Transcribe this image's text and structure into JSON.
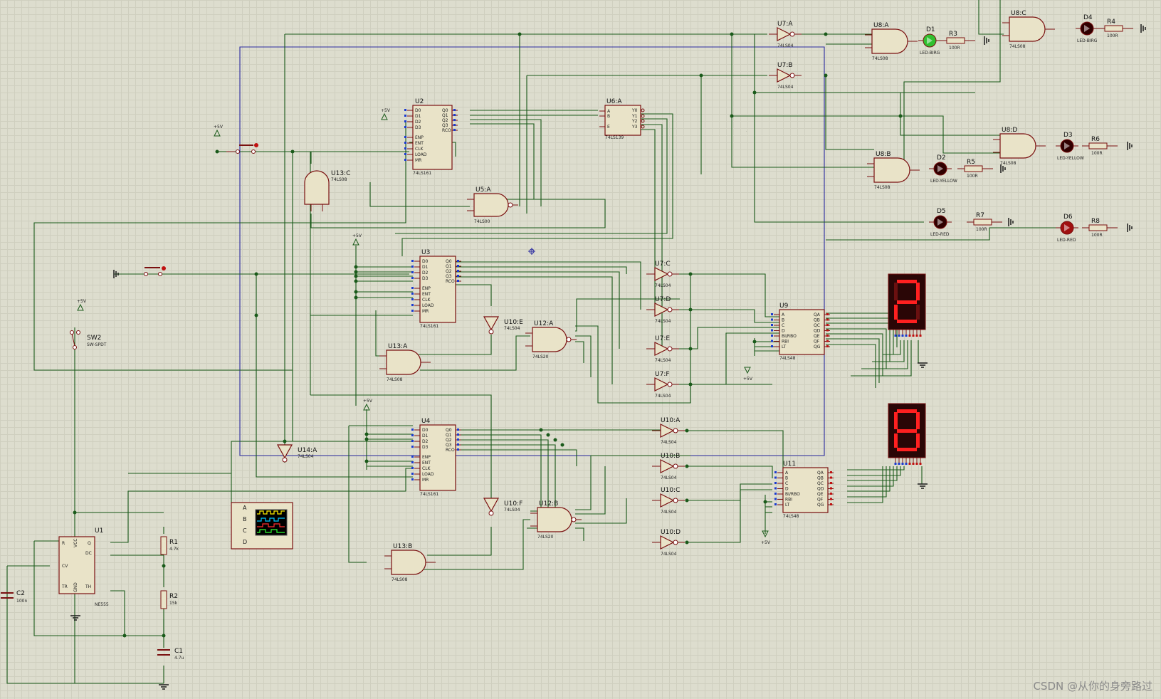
{
  "components": {
    "U1": {
      "ref": "U1",
      "type": "NE555",
      "pins": [
        "R",
        "VCC",
        "Q",
        "DC",
        "CV",
        "TR",
        "GND",
        "TH"
      ]
    },
    "U2": {
      "ref": "U2",
      "type": "74LS161"
    },
    "U3": {
      "ref": "U3",
      "type": "74LS161"
    },
    "U4": {
      "ref": "U4",
      "type": "74LS161"
    },
    "U6A": {
      "ref": "U6:A",
      "type": "74LS139",
      "pins": [
        "A",
        "B",
        "E",
        "Y0",
        "Y1",
        "Y2",
        "Y3"
      ]
    },
    "U9": {
      "ref": "U9",
      "type": "74LS48"
    },
    "U11": {
      "ref": "U11",
      "type": "74LS48"
    },
    "U5A": {
      "ref": "U5:A",
      "type": "74LS00"
    },
    "U8A": {
      "ref": "U8:A",
      "type": "74LS08"
    },
    "U8B": {
      "ref": "U8:B",
      "type": "74LS08"
    },
    "U8C": {
      "ref": "U8:C",
      "type": "74LS08"
    },
    "U8D": {
      "ref": "U8:D",
      "type": "74LS08"
    },
    "U13A": {
      "ref": "U13:A",
      "type": "74LS08"
    },
    "U13B": {
      "ref": "U13:B",
      "type": "74LS08"
    },
    "U13C": {
      "ref": "U13:C",
      "type": "74LS08"
    },
    "U12A": {
      "ref": "U12:A",
      "type": "74LS20"
    },
    "U12B": {
      "ref": "U12:B",
      "type": "74LS20"
    },
    "U7A": {
      "ref": "U7:A",
      "type": "74LS04"
    },
    "U7B": {
      "ref": "U7:B",
      "type": "74LS04"
    },
    "U7C": {
      "ref": "U7:C",
      "type": "74LS04"
    },
    "U7D": {
      "ref": "U7:D",
      "type": "74LS04"
    },
    "U7E": {
      "ref": "U7:E",
      "type": "74LS04"
    },
    "U7F": {
      "ref": "U7:F",
      "type": "74LS04"
    },
    "U10A": {
      "ref": "U10:A",
      "type": "74LS04"
    },
    "U10B": {
      "ref": "U10:B",
      "type": "74LS04"
    },
    "U10C": {
      "ref": "U10:C",
      "type": "74LS04"
    },
    "U10D": {
      "ref": "U10:D",
      "type": "74LS04"
    },
    "U10E": {
      "ref": "U10:E",
      "type": "74LS04"
    },
    "U10F": {
      "ref": "U10:F",
      "type": "74LS04"
    },
    "U14A": {
      "ref": "U14:A",
      "type": "74LS04"
    },
    "R1": {
      "ref": "R1",
      "value": "4.7k"
    },
    "R2": {
      "ref": "R2",
      "value": "15k"
    },
    "R3": {
      "ref": "R3",
      "value": "100R"
    },
    "R4": {
      "ref": "R4",
      "value": "100R"
    },
    "R5": {
      "ref": "R5",
      "value": "100R"
    },
    "R6": {
      "ref": "R6",
      "value": "100R"
    },
    "R7": {
      "ref": "R7",
      "value": "100R"
    },
    "R8": {
      "ref": "R8",
      "value": "100R"
    },
    "C1": {
      "ref": "C1",
      "value": "4.7u"
    },
    "C2": {
      "ref": "C2",
      "value": "100n"
    },
    "D1": {
      "ref": "D1",
      "type": "LED-BIRG"
    },
    "D2": {
      "ref": "D2",
      "type": "LED-YELLOW"
    },
    "D3": {
      "ref": "D3",
      "type": "LED-YELLOW"
    },
    "D4": {
      "ref": "D4",
      "type": "LED-BIRG"
    },
    "D5": {
      "ref": "D5",
      "type": "LED-RED"
    },
    "D6": {
      "ref": "D6",
      "type": "LED-RED"
    },
    "SW2": {
      "ref": "SW2",
      "type": "SW-SPDT"
    }
  },
  "counter_pins": {
    "left": [
      "D0",
      "D1",
      "D2",
      "D3",
      "ENP",
      "ENT",
      "CLK",
      "LOAD",
      "MR"
    ],
    "right": [
      "Q0",
      "Q1",
      "Q2",
      "Q3",
      "RCO"
    ]
  },
  "decoder_pins": {
    "left": [
      "A",
      "B",
      "C",
      "D",
      "BI/RBO",
      "RBI",
      "LT"
    ],
    "right": [
      "QA",
      "QB",
      "QC",
      "QD",
      "QE",
      "QF",
      "QG"
    ]
  },
  "supply": {
    "plus5v": "+5V"
  },
  "scope_channels": [
    "A",
    "B",
    "C",
    "D"
  ],
  "displays": {
    "upper_digit": "2",
    "lower_digit": "8"
  },
  "watermark": "CSDN @从你的身旁路过"
}
